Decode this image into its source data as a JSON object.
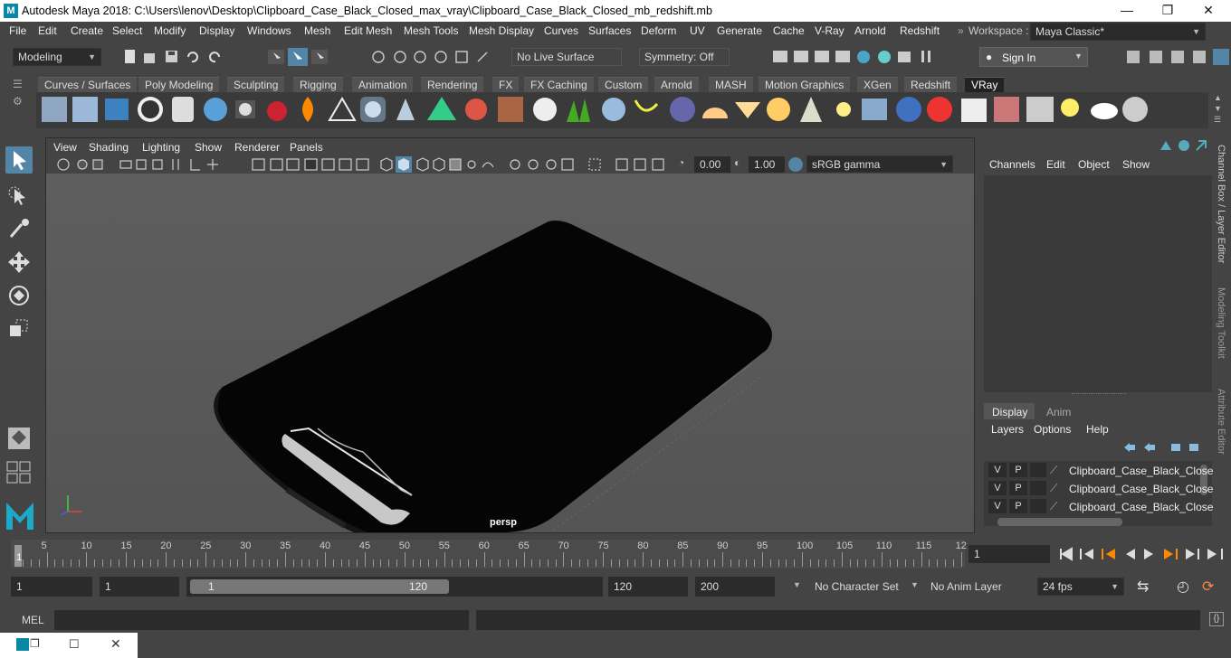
{
  "window": {
    "title": "Autodesk Maya 2018: C:\\Users\\lenov\\Desktop\\Clipboard_Case_Black_Closed_max_vray\\Clipboard_Case_Black_Closed_mb_redshift.mb",
    "logo_letter": "M"
  },
  "menu": [
    "File",
    "Edit",
    "Create",
    "Select",
    "Modify",
    "Display",
    "Windows",
    "Mesh",
    "Edit Mesh",
    "Mesh Tools",
    "Mesh Display",
    "Curves",
    "Surfaces",
    "Deform",
    "UV",
    "Generate",
    "Cache",
    "V-Ray",
    "Arnold",
    "Redshift"
  ],
  "workspace": {
    "label": "Workspace :",
    "value": "Maya Classic*"
  },
  "status": {
    "mode": "Modeling",
    "live_surface": "No Live Surface",
    "symmetry": "Symmetry: Off",
    "sign_in": "Sign In"
  },
  "shelf_tabs": [
    "Curves / Surfaces",
    "Poly Modeling",
    "Sculpting",
    "Rigging",
    "Animation",
    "Rendering",
    "FX",
    "FX Caching",
    "Custom",
    "Arnold",
    "MASH",
    "Motion Graphics",
    "XGen",
    "Redshift",
    "VRay"
  ],
  "shelf_active": "VRay",
  "panel": {
    "menu": [
      "View",
      "Shading",
      "Lighting",
      "Show",
      "Renderer",
      "Panels"
    ],
    "exposure": "0.00",
    "gamma": "1.00",
    "color_space": "sRGB gamma",
    "camera": "persp"
  },
  "channel_box": {
    "menu": [
      "Channels",
      "Edit",
      "Object",
      "Show"
    ],
    "tabs": [
      "Display",
      "Anim"
    ],
    "layer_menu": [
      "Layers",
      "Options",
      "Help"
    ],
    "layers": [
      {
        "v": "V",
        "p": "P",
        "name": "Clipboard_Case_Black_Close"
      },
      {
        "v": "V",
        "p": "P",
        "name": "Clipboard_Case_Black_Close"
      },
      {
        "v": "V",
        "p": "P",
        "name": "Clipboard_Case_Black_Close"
      }
    ],
    "side_tabs": [
      "Channel Box / Layer Editor",
      "Modeling Toolkit",
      "Attribute Editor"
    ]
  },
  "timeline": {
    "ticks": [
      "5",
      "10",
      "15",
      "20",
      "25",
      "30",
      "35",
      "40",
      "45",
      "50",
      "55",
      "60",
      "65",
      "70",
      "75",
      "80",
      "85",
      "90",
      "95",
      "100",
      "105",
      "110",
      "115",
      "12"
    ],
    "current": "1",
    "current_frame_field": "1"
  },
  "range": {
    "start": "1",
    "playback_start": "1",
    "slider_start": "1",
    "slider_end": "120",
    "playback_end": "120",
    "end": "200",
    "character_set": "No Character Set",
    "anim_layer": "No Anim Layer",
    "fps": "24 fps"
  },
  "cmdline": {
    "label": "MEL"
  },
  "colors": {
    "accent": "#5285a6",
    "background": "#444444",
    "viewport": "#5c5c5c",
    "model": "#050505"
  }
}
